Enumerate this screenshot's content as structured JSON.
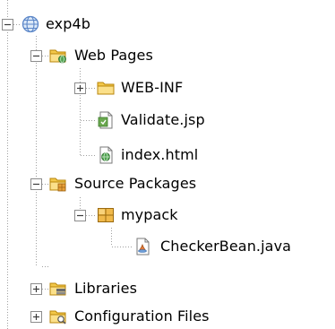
{
  "tree": {
    "root": {
      "label": "exp4b",
      "icon": "web-project-globe-icon",
      "state": "expanded"
    },
    "web_pages": {
      "label": "Web Pages",
      "icon": "web-pages-folder-icon",
      "state": "expanded",
      "children": [
        {
          "label": "WEB-INF",
          "icon": "folder-icon",
          "state": "collapsed"
        },
        {
          "label": "Validate.jsp",
          "icon": "jsp-file-icon"
        },
        {
          "label": "index.html",
          "icon": "html-file-icon"
        }
      ]
    },
    "source_packages": {
      "label": "Source Packages",
      "icon": "source-packages-folder-icon",
      "state": "expanded",
      "package": {
        "label": "mypack",
        "icon": "package-icon",
        "state": "expanded",
        "children": [
          {
            "label": "CheckerBean.java",
            "icon": "java-file-icon"
          }
        ]
      }
    },
    "libraries": {
      "label": "Libraries",
      "icon": "libraries-folder-icon",
      "state": "collapsed"
    },
    "configuration_files": {
      "label": "Configuration Files",
      "icon": "configuration-folder-icon",
      "state": "collapsed"
    }
  },
  "colors": {
    "tree_line": "#a0a0a0",
    "toggle_border": "#8c8c8c",
    "folder_yellow": "#f3c84a",
    "folder_dark": "#d9a520",
    "globe_blue": "#5b86c8"
  }
}
